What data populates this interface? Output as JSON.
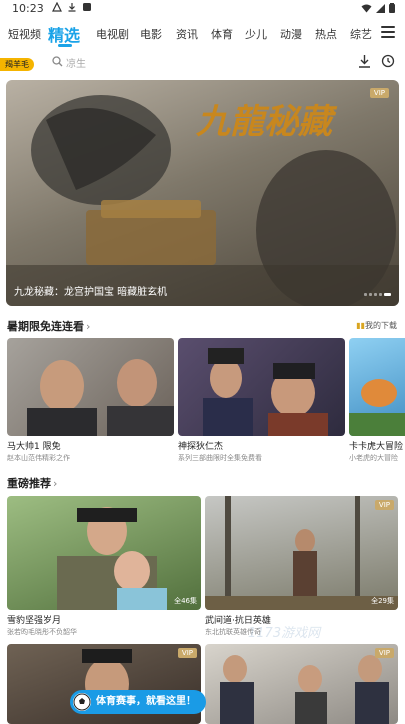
{
  "status_bar": {
    "time": "10:23"
  },
  "nav": {
    "tabs": [
      "短视频",
      "精选",
      "电视剧",
      "电影",
      "资讯",
      "体育",
      "少儿",
      "动漫",
      "热点",
      "综艺"
    ],
    "active": "精选"
  },
  "search": {
    "badge": "羯羊毛",
    "placeholder": "凉生"
  },
  "banner": {
    "title_art": "九龍秘藏",
    "vip": "VIP",
    "caption": "九龙秘藏：龙宫护国宝 暗藏脏玄机"
  },
  "section1": {
    "title": "暑期限免连连看",
    "my_downloads": "我的下载",
    "items": [
      {
        "title": "马大帅1 限免",
        "subtitle": "赵本山范伟精彩之作"
      },
      {
        "title": "神探狄仁杰",
        "subtitle": "系列三部曲限时全集免费看"
      },
      {
        "title": "卡卡虎大冒险",
        "subtitle": "小老虎的大冒险"
      }
    ]
  },
  "section2": {
    "title": "重磅推荐",
    "items": [
      {
        "title": "雪豹坚强岁月",
        "subtitle": "张若昀毛晓彤不负韶华",
        "episodes": "全46集",
        "vip": ""
      },
      {
        "title": "武间道·抗日英雄",
        "subtitle": "东北抗联英雄传奇",
        "episodes": "全29集",
        "vip": "VIP"
      },
      {
        "vip": "VIP"
      },
      {
        "vip": "VIP"
      }
    ]
  },
  "floating": {
    "sports_label": "体育赛事，就看这里！"
  },
  "watermark": "1173游戏网",
  "colors": {
    "accent": "#1aa3e8",
    "badge": "#f5b400",
    "vip": "#c9a96a",
    "sports": "#1a9be6"
  }
}
